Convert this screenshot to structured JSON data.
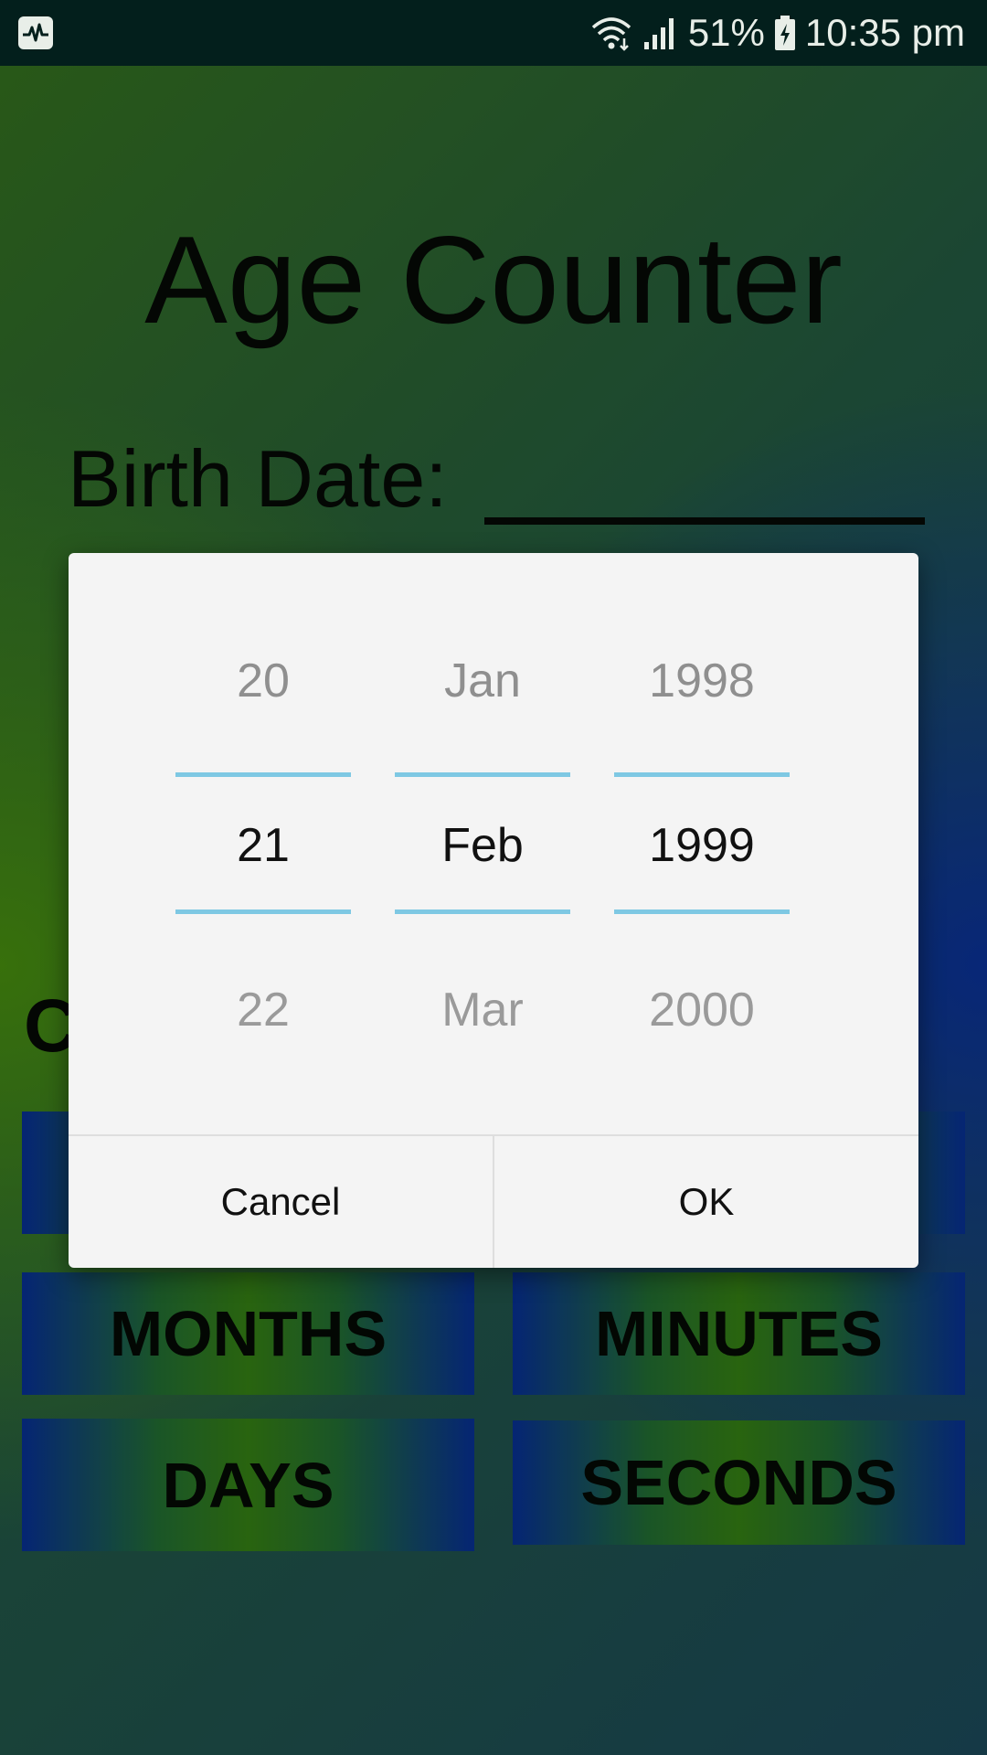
{
  "status_bar": {
    "battery": "51%",
    "time": "10:35 pm",
    "icons": [
      "activity-monitor-icon",
      "wifi-icon",
      "signal-icon",
      "battery-charging-icon"
    ]
  },
  "app": {
    "title": "Age Counter",
    "birth_label": "Birth Date:",
    "partial_heading": "C"
  },
  "buttons": {
    "months": "MONTHS",
    "minutes": "MINUTES",
    "days": "DAYS",
    "seconds": "SECONDS"
  },
  "date_picker": {
    "day": {
      "prev": "20",
      "current": "21",
      "next": "22"
    },
    "month": {
      "prev": "Jan",
      "current": "Feb",
      "next": "Mar"
    },
    "year": {
      "prev": "1998",
      "current": "1999",
      "next": "2000"
    },
    "cancel_label": "Cancel",
    "ok_label": "OK",
    "accent_color": "#7ec8e3"
  }
}
